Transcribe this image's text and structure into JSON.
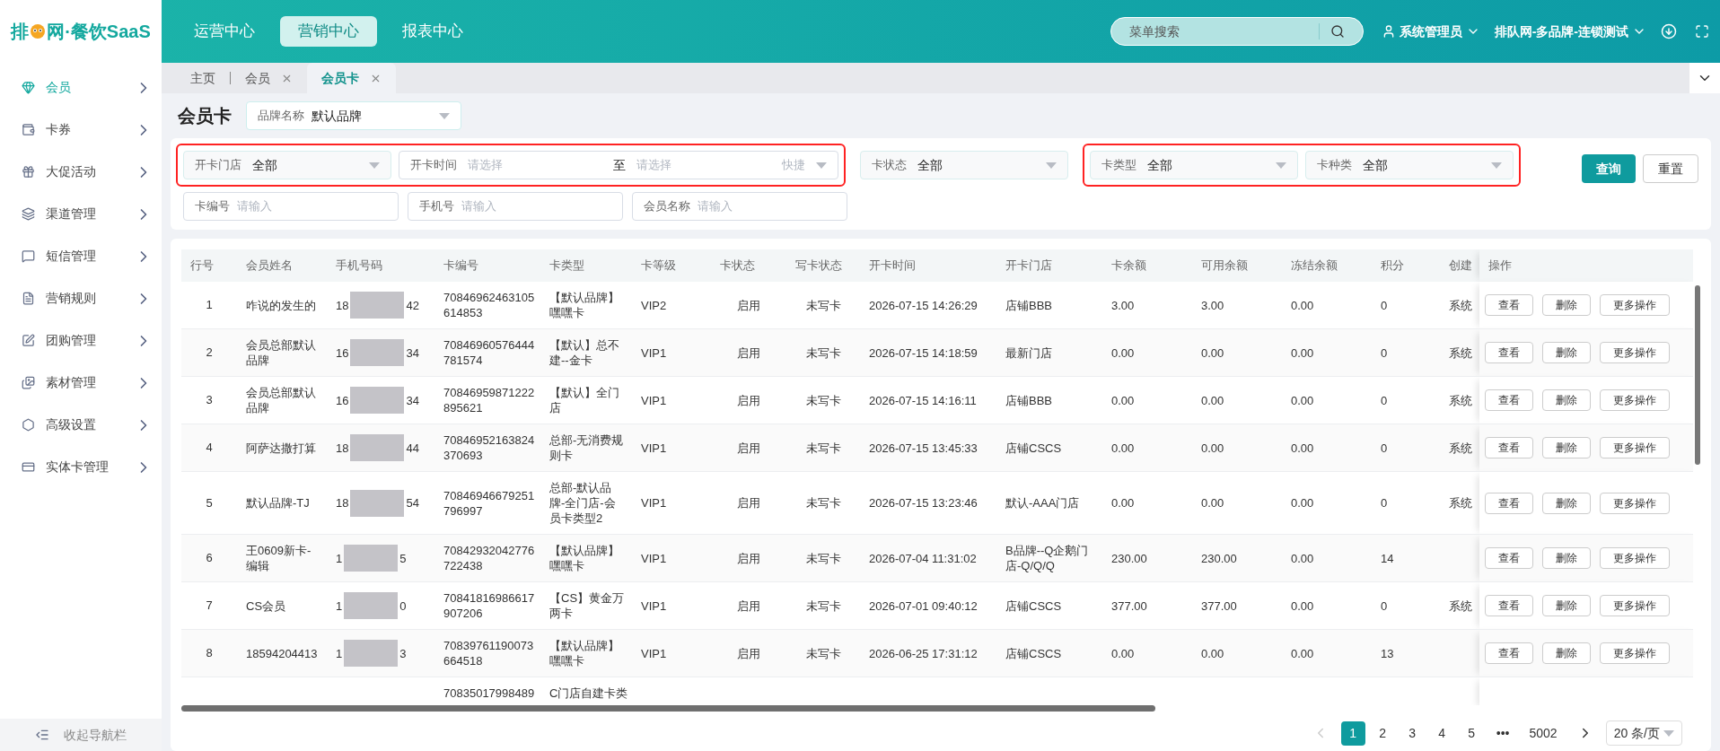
{
  "logo": {
    "text_start": "排",
    "text_end": "网·餐饮SaaS"
  },
  "top_nav": [
    {
      "label": "运营中心",
      "selected": false
    },
    {
      "label": "营销中心",
      "selected": true
    },
    {
      "label": "报表中心",
      "selected": false
    }
  ],
  "search": {
    "placeholder": "菜单搜索"
  },
  "user": "系统管理员",
  "org": "排队网-多品牌-连锁测试",
  "sidebar": {
    "items": [
      {
        "label": "会员",
        "selected": true
      },
      {
        "label": "卡券",
        "selected": false
      },
      {
        "label": "大促活动",
        "selected": false
      },
      {
        "label": "渠道管理",
        "selected": false
      },
      {
        "label": "短信管理",
        "selected": false
      },
      {
        "label": "营销规则",
        "selected": false
      },
      {
        "label": "团购管理",
        "selected": false
      },
      {
        "label": "素材管理",
        "selected": false
      },
      {
        "label": "高级设置",
        "selected": false
      },
      {
        "label": "实体卡管理",
        "selected": false
      }
    ],
    "footer": "收起导航栏"
  },
  "tabs": [
    {
      "label": "主页",
      "closable": false,
      "selected": false
    },
    {
      "label": "会员",
      "closable": true,
      "selected": false
    },
    {
      "label": "会员卡",
      "closable": true,
      "selected": true
    }
  ],
  "page_title": "会员卡",
  "brand_select": {
    "label": "品牌名称",
    "value": "默认品牌"
  },
  "filter_row_1": [
    {
      "highlighted": true,
      "filters": [
        {
          "kind": "select",
          "label": "开卡门店",
          "value": "全部"
        },
        {
          "kind": "date_range",
          "label": "开卡时间",
          "start_placeholder": "请选择",
          "separator": "至",
          "end_placeholder": "请选择",
          "shortcut": "快捷"
        }
      ]
    },
    {
      "highlighted": false,
      "filters": [
        {
          "kind": "select",
          "label": "卡状态",
          "value": "全部"
        }
      ]
    },
    {
      "highlighted": true,
      "filters": [
        {
          "kind": "select",
          "label": "卡类型",
          "value": "全部"
        },
        {
          "kind": "select",
          "label": "卡种类",
          "value": "全部"
        }
      ]
    }
  ],
  "filter_row_2": [
    {
      "kind": "input",
      "label": "卡编号",
      "placeholder": "请输入"
    },
    {
      "kind": "input",
      "label": "手机号",
      "placeholder": "请输入"
    },
    {
      "kind": "input",
      "label": "会员名称",
      "placeholder": "请输入"
    }
  ],
  "buttons": [
    {
      "label": "查询",
      "primary": true
    },
    {
      "label": "重置",
      "primary": false
    }
  ],
  "table": {
    "columns": [
      "行号",
      "会员姓名",
      "手机号码",
      "卡编号",
      "卡类型",
      "卡等级",
      "卡状态",
      "写卡状态",
      "开卡时间",
      "开卡门店",
      "卡余额",
      "可用余额",
      "冻结余额",
      "积分",
      "创建",
      "操作"
    ],
    "rows": [
      {
        "no": "1",
        "name": "咋说的发生的",
        "phone_start": "18",
        "phone_end": "42",
        "card_no": "70846962463105614853",
        "card_type": "【默认品牌】嘿嘿卡",
        "level": "VIP2",
        "status": "启用",
        "write_status": "未写卡",
        "opened_at": "2026-07-15 14:26:29",
        "store": "店铺BBB",
        "balance": "3.00",
        "available": "3.00",
        "frozen": "0.00",
        "points": "0",
        "creator": "系统",
        "actions": [
          "查看",
          "删除",
          "更多操作"
        ]
      },
      {
        "no": "2",
        "name": "会员总部默认品牌",
        "phone_start": "16",
        "phone_end": "34",
        "card_no": "70846960576444781574",
        "card_type": "【默认】总不建--金卡",
        "level": "VIP1",
        "status": "启用",
        "write_status": "未写卡",
        "opened_at": "2026-07-15 14:18:59",
        "store": "最新门店",
        "balance": "0.00",
        "available": "0.00",
        "frozen": "0.00",
        "points": "0",
        "creator": "系统",
        "actions": [
          "查看",
          "删除",
          "更多操作"
        ]
      },
      {
        "no": "3",
        "name": "会员总部默认品牌",
        "phone_start": "16",
        "phone_end": "34",
        "card_no": "70846959871222895621",
        "card_type": "【默认】全门店",
        "level": "VIP1",
        "status": "启用",
        "write_status": "未写卡",
        "opened_at": "2026-07-15 14:16:11",
        "store": "店铺BBB",
        "balance": "0.00",
        "available": "0.00",
        "frozen": "0.00",
        "points": "0",
        "creator": "系统",
        "actions": [
          "查看",
          "删除",
          "更多操作"
        ]
      },
      {
        "no": "4",
        "name": "阿萨达撒打算",
        "phone_start": "18",
        "phone_end": "44",
        "card_no": "70846952163824370693",
        "card_type": "总部-无消费规则卡",
        "level": "VIP1",
        "status": "启用",
        "write_status": "未写卡",
        "opened_at": "2026-07-15 13:45:33",
        "store": "店铺CSCS",
        "balance": "0.00",
        "available": "0.00",
        "frozen": "0.00",
        "points": "0",
        "creator": "系统",
        "actions": [
          "查看",
          "删除",
          "更多操作"
        ]
      },
      {
        "no": "5",
        "name": "默认品牌-TJ",
        "phone_start": "18",
        "phone_end": "54",
        "card_no": "70846946679251796997",
        "card_type": "总部-默认品牌-全门店-会员卡类型2",
        "level": "VIP1",
        "status": "启用",
        "write_status": "未写卡",
        "opened_at": "2026-07-15 13:23:46",
        "store": "默认-AAA门店",
        "balance": "0.00",
        "available": "0.00",
        "frozen": "0.00",
        "points": "0",
        "creator": "系统",
        "actions": [
          "查看",
          "删除",
          "更多操作"
        ]
      },
      {
        "no": "6",
        "name": "王0609新卡-编辑",
        "phone_start": "1",
        "phone_end": "5",
        "card_no": "70842932042776722438",
        "card_type": "【默认品牌】嘿嘿卡",
        "level": "VIP1",
        "status": "启用",
        "write_status": "未写卡",
        "opened_at": "2026-07-04 11:31:02",
        "store": "B品牌--Q企鹅门店-Q/Q/Q",
        "balance": "230.00",
        "available": "230.00",
        "frozen": "0.00",
        "points": "14",
        "actions": [
          "查看",
          "删除",
          "更多操作"
        ]
      },
      {
        "no": "7",
        "name": "CS会员",
        "phone_start": "1",
        "phone_end": "0",
        "card_no": "70841816986617907206",
        "card_type": "【CS】黄金万两卡",
        "level": "VIP1",
        "status": "启用",
        "write_status": "未写卡",
        "opened_at": "2026-07-01 09:40:12",
        "store": "店铺CSCS",
        "balance": "377.00",
        "available": "377.00",
        "frozen": "0.00",
        "points": "0",
        "creator": "系统",
        "actions": [
          "查看",
          "删除",
          "更多操作"
        ]
      },
      {
        "no": "8",
        "name": "18594204413",
        "phone_start": "1",
        "phone_end": "3",
        "card_no": "70839761190073664518",
        "card_type": "【默认品牌】嘿嘿卡",
        "level": "VIP1",
        "status": "启用",
        "write_status": "未写卡",
        "opened_at": "2026-06-25 17:31:12",
        "store": "店铺CSCS",
        "balance": "0.00",
        "available": "0.00",
        "frozen": "0.00",
        "points": "13",
        "actions": [
          "查看",
          "删除",
          "更多操作"
        ]
      },
      {
        "card_no": "70835017998489",
        "card_type": "C门店自建卡类"
      }
    ]
  },
  "pagination": {
    "pages": [
      {
        "label": "1",
        "selected": true
      },
      {
        "label": "2",
        "selected": false
      },
      {
        "label": "3",
        "selected": false
      },
      {
        "label": "4",
        "selected": false
      },
      {
        "label": "5",
        "selected": false
      },
      {
        "label": "•••",
        "selected": false
      },
      {
        "label": "5002",
        "selected": false
      }
    ],
    "prev_disabled": true,
    "page_size": "20 条/页"
  }
}
